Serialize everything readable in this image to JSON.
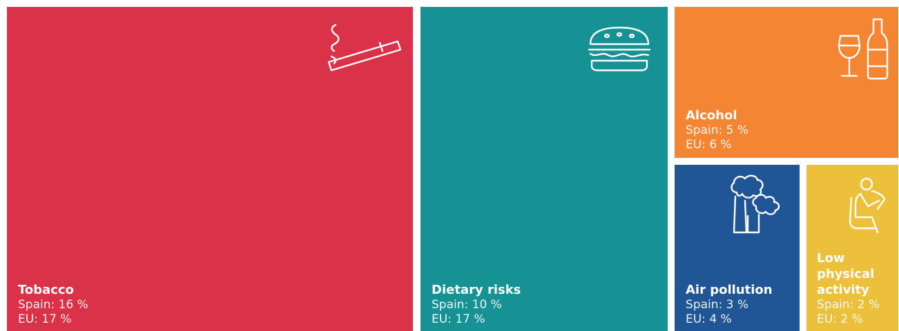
{
  "chart_data": {
    "type": "treemap",
    "items": [
      {
        "name": "Tobacco",
        "spain_label": "Spain: 16 %",
        "eu_label": "EU: 17 %",
        "spain": 16,
        "eu": 17,
        "color": "#D93249",
        "icon": "cigarette-icon"
      },
      {
        "name": "Dietary risks",
        "spain_label": "Spain: 10 %",
        "eu_label": "EU: 17 %",
        "spain": 10,
        "eu": 17,
        "color": "#169295",
        "icon": "burger-icon"
      },
      {
        "name": "Alcohol",
        "spain_label": "Spain: 5 %",
        "eu_label": "EU: 6 %",
        "spain": 5,
        "eu": 6,
        "color": "#F48533",
        "icon": "wine-bottle-glass-icon"
      },
      {
        "name": "Air pollution",
        "spain_label": "Spain: 3 %",
        "eu_label": "EU: 4 %",
        "spain": 3,
        "eu": 4,
        "color": "#205695",
        "icon": "factory-smoke-icon"
      },
      {
        "name": "Low physical activity",
        "name_lines": [
          "Low",
          "physical",
          "activity"
        ],
        "spain_label": "Spain: 2 %",
        "eu_label": "EU: 2 %",
        "spain": 2,
        "eu": 2,
        "color": "#ECC03B",
        "icon": "sitting-person-icon"
      }
    ]
  }
}
